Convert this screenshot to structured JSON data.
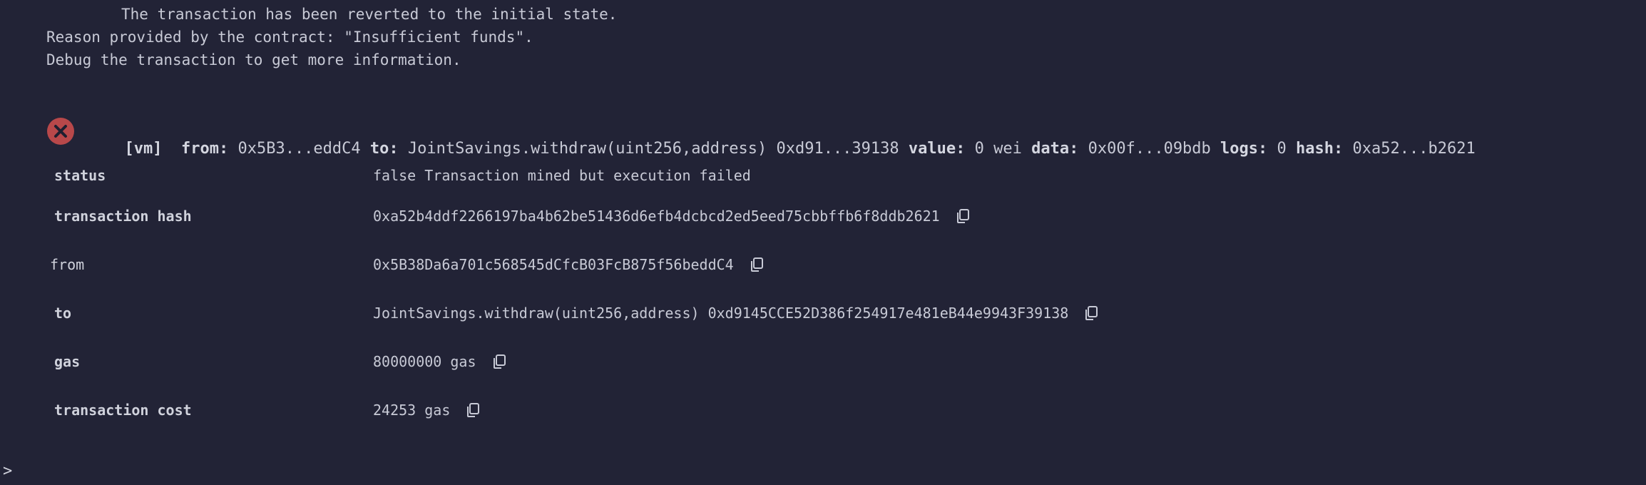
{
  "log": {
    "line1": "The transaction has been reverted to the initial state.",
    "line2": "Reason provided by the contract: \"Insufficient funds\".",
    "line3": "Debug the transaction to get more information."
  },
  "summary": {
    "env": "[vm]",
    "from_key": "from:",
    "from_val": "0x5B3...eddC4",
    "to_key": "to:",
    "to_val": "JointSavings.withdraw(uint256,address) 0xd91...39138",
    "value_key": "value:",
    "value_val": "0 wei",
    "data_key": "data:",
    "data_val": "0x00f...09bdb",
    "logs_key": "logs:",
    "logs_val": "0",
    "hash_key": "hash:",
    "hash_val": "0xa52...b2621"
  },
  "details": {
    "status": {
      "label": "status",
      "value": "false Transaction mined but execution failed"
    },
    "tx_hash": {
      "label": "transaction hash",
      "value": "0xa52b4ddf2266197ba4b62be51436d6efb4dcbcd2ed5eed75cbbffb6f8ddb2621"
    },
    "from": {
      "label": "from",
      "value": "0x5B38Da6a701c568545dCfcB03FcB875f56beddC4"
    },
    "to": {
      "label": "to",
      "value": "JointSavings.withdraw(uint256,address) 0xd9145CCE52D386f254917e481eB44e9943F39138"
    },
    "gas": {
      "label": "gas",
      "value": "80000000 gas"
    },
    "tx_cost": {
      "label": "transaction cost",
      "value": "24253 gas"
    }
  },
  "prompt": ">",
  "icons": {
    "error": "error-x-icon",
    "copy": "copy-icon"
  },
  "colors": {
    "background": "#222336",
    "error": "#b8484a",
    "text": "#c8cad6"
  }
}
